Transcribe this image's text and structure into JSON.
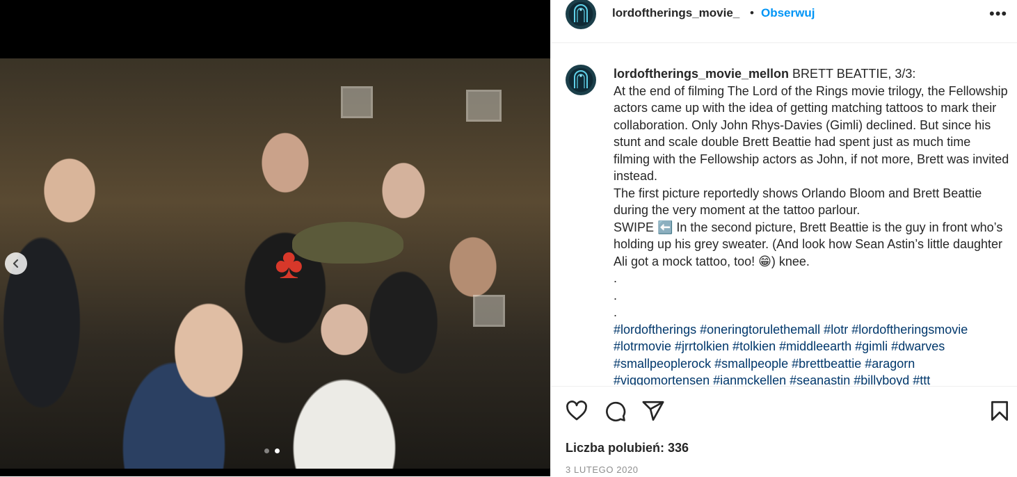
{
  "post": {
    "account": "lordoftherings_movie_",
    "bullet": "•",
    "follow_label": "Obserwuj",
    "more_label": "•••"
  },
  "caption": {
    "username": "lordoftherings_movie_mellon",
    "text": " BRETT BEATTIE, 3/3:\nAt the end of filming The Lord of the Rings movie trilogy, the Fellowship actors came up with the idea of getting matching tattoos to mark their collaboration. Only John Rhys-Davies (Gimli) declined. But since his stunt and scale double Brett Beattie had spent just as much time filming with the Fellowship actors as John, if not more, Brett was invited instead.\nThe first picture reportedly shows Orlando Bloom and Brett Beattie during the very moment at the tattoo parlour.\nSWIPE ⬅️ In the second picture, Brett Beattie is the guy in front who’s holding up his grey sweater. (And look how Sean Astin’s little daughter Ali got a mock tattoo, too! 😁) knee.\n.\n.\n.\n",
    "hashtags": "#lordoftherings #oneringtorulethemall #lotr #lordoftheringsmovie #lotrmovie #jrrtolkien #tolkien #middleearth #gimli #dwarves #smallpeoplerock #smallpeople #brettbeattie #aragorn #viggomortensen #ianmckellen #seanastin #billyboyd #ttt"
  },
  "footer": {
    "likes_label": "Liczba polubień: 336",
    "date": "3 LUTEGO 2020"
  },
  "media": {
    "carousel_total": 2,
    "carousel_active": 2
  },
  "icons": {
    "prev": "chevron-left-icon",
    "like": "heart-icon",
    "comment": "comment-icon",
    "share": "paper-plane-icon",
    "save": "bookmark-icon",
    "more": "more-options-icon"
  },
  "colors": {
    "link_blue": "#0095f6",
    "hashtag": "#00376b",
    "meta_grey": "#8e8e8e"
  }
}
